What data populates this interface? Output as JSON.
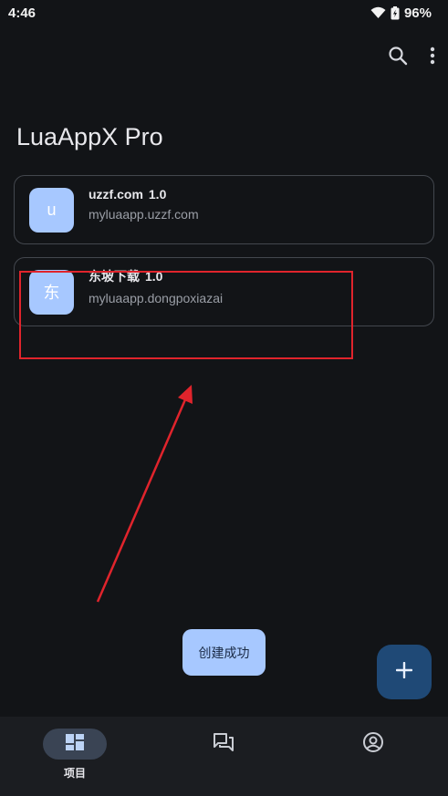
{
  "status_bar": {
    "time": "4:46",
    "battery_percent": "96%",
    "icons": [
      "wifi-icon",
      "battery-icon"
    ]
  },
  "app_bar": {
    "icons": [
      "search-icon",
      "more-vert-icon"
    ]
  },
  "page": {
    "title": "LuaAppX Pro"
  },
  "projects": [
    {
      "avatar": "u",
      "name": "uzzf.com",
      "version": "1.0",
      "package": "myluaapp.uzzf.com"
    },
    {
      "avatar": "东",
      "name": "东坡下载",
      "version": "1.0",
      "package": "myluaapp.dongpoxiazai"
    }
  ],
  "toast": {
    "text": "创建成功"
  },
  "fab": {
    "icon": "add-icon"
  },
  "bottom_nav": {
    "items": [
      {
        "label": "项目",
        "icon": "dashboard-icon",
        "selected": true
      },
      {
        "label": "",
        "icon": "forum-icon",
        "selected": false
      },
      {
        "label": "",
        "icon": "account-circle-icon",
        "selected": false
      }
    ]
  },
  "colors": {
    "background": "#121417",
    "avatar": "#a7c8ff",
    "fab": "#1f4976",
    "annotation": "#e0242c",
    "nav_indicator": "#3a4454"
  }
}
